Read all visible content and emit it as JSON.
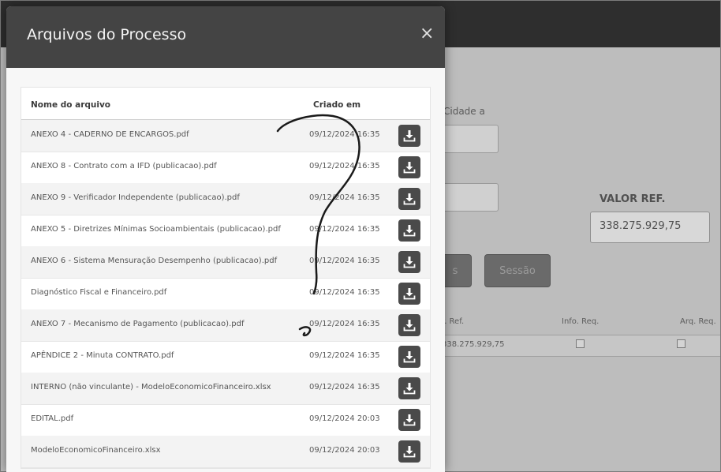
{
  "background": {
    "field_label": "Cidade a",
    "valor_label": "VALOR REF.",
    "valor_value": "338.275.929,75",
    "button_left": "s",
    "button_sessao": "Sessão",
    "table_headers": [
      "r. Ref.",
      "Info. Req.",
      "Arq. Req."
    ],
    "table_row_value": "338.275.929,75"
  },
  "modal": {
    "title": "Arquivos do Processo",
    "close_symbol": "×",
    "columns": {
      "name": "Nome do arquivo",
      "created": "Criado em"
    },
    "files": [
      {
        "name": "ANEXO 4 - CADERNO DE ENCARGOS.pdf",
        "created": "09/12/2024 16:35"
      },
      {
        "name": "ANEXO 8 - Contrato com a IFD (publicacao).pdf",
        "created": "09/12/2024 16:35"
      },
      {
        "name": "ANEXO 9 - Verificador Independente (publicacao).pdf",
        "created": "09/12/2024 16:35"
      },
      {
        "name": "ANEXO 5 - Diretrizes Mínimas Socioambientais (publicacao).pdf",
        "created": "09/12/2024 16:35"
      },
      {
        "name": "ANEXO 6 - Sistema Mensuração Desempenho (publicacao).pdf",
        "created": "09/12/2024 16:35"
      },
      {
        "name": "Diagnóstico Fiscal e Financeiro.pdf",
        "created": "09/12/2024 16:35"
      },
      {
        "name": "ANEXO 7 - Mecanismo de Pagamento (publicacao).pdf",
        "created": "09/12/2024 16:35"
      },
      {
        "name": "APÊNDICE 2 - Minuta CONTRATO.pdf",
        "created": "09/12/2024 16:35"
      },
      {
        "name": "INTERNO (não vinculante) - ModeloEconomicoFinanceiro.xlsx",
        "created": "09/12/2024 16:35"
      },
      {
        "name": "EDITAL.pdf",
        "created": "09/12/2024 20:03"
      },
      {
        "name": "ModeloEconomicoFinanceiro.xlsx",
        "created": "09/12/2024 20:03"
      }
    ],
    "download_icon": "download-icon"
  },
  "colors": {
    "header_bg": "#444444",
    "download_button": "#4a4a4a",
    "overlay_page": "#bdbdbd"
  }
}
